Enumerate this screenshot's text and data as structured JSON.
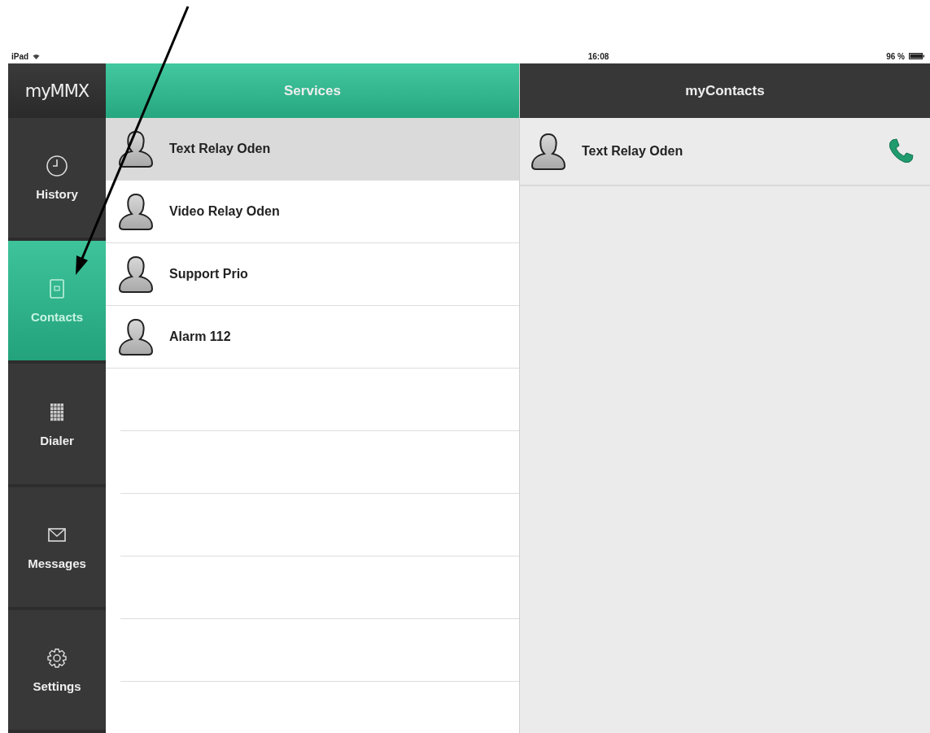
{
  "status_bar": {
    "device": "iPad",
    "time": "16:08",
    "battery": "96 %"
  },
  "logo": "myMMX",
  "sidebar": {
    "items": [
      {
        "label": "History",
        "kind": "history",
        "selected": false
      },
      {
        "label": "Contacts",
        "kind": "contacts",
        "selected": true
      },
      {
        "label": "Dialer",
        "kind": "dialer",
        "selected": false
      },
      {
        "label": "Messages",
        "kind": "messages",
        "selected": false
      },
      {
        "label": "Settings",
        "kind": "settings",
        "selected": false
      }
    ]
  },
  "services": {
    "title": "Services",
    "items": [
      {
        "name": "Text Relay Oden",
        "selected": true
      },
      {
        "name": "Video Relay Oden",
        "selected": false
      },
      {
        "name": "Support Prio",
        "selected": false
      },
      {
        "name": "Alarm 112",
        "selected": false
      }
    ]
  },
  "my_contacts": {
    "title": "myContacts",
    "items": [
      {
        "name": "Text Relay Oden"
      }
    ]
  }
}
